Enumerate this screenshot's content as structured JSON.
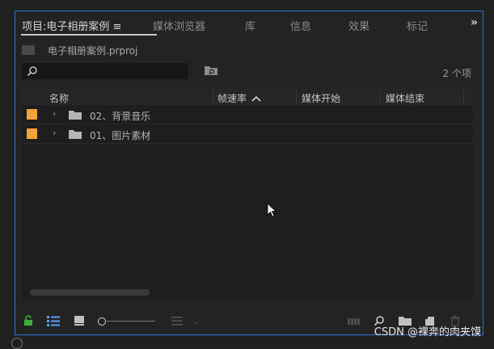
{
  "tabs": [
    {
      "label": "项目:电子相册案例",
      "active": true
    },
    {
      "label": "媒体浏览器",
      "active": false
    },
    {
      "label": "库",
      "active": false
    },
    {
      "label": "信息",
      "active": false
    },
    {
      "label": "效果",
      "active": false
    },
    {
      "label": "标记",
      "active": false
    }
  ],
  "tab_menu_glyph": "≡",
  "more_glyph": "»",
  "project": {
    "filename": "电子相册案例.prproj",
    "icon": "project-file-icon"
  },
  "search": {
    "value": "",
    "placeholder": ""
  },
  "item_count": "2 个项",
  "columns": [
    "名称",
    "帧速率",
    "媒体开始",
    "媒体结束"
  ],
  "sorted_column": "帧速率",
  "sort_direction": "ascending",
  "rows": [
    {
      "name": "02、背景音乐",
      "label_color": "#f2a33a",
      "type": "bin"
    },
    {
      "name": "01、图片素材",
      "label_color": "#f2a33a",
      "type": "bin"
    }
  ],
  "toolbar_icons": [
    "lock-icon",
    "list-view-icon",
    "icon-view-icon",
    "zoom-slider",
    "sort-icons-icon",
    "automate-to-sequence-icon",
    "find-icon",
    "new-bin-icon",
    "new-item-icon",
    "clear-icon"
  ],
  "colors": {
    "accent_border": "#2d6fd6",
    "label_orange": "#f2a33a",
    "lock_green": "#3fae3f"
  },
  "watermark": "CSDN @裸奔的肉夹馍"
}
